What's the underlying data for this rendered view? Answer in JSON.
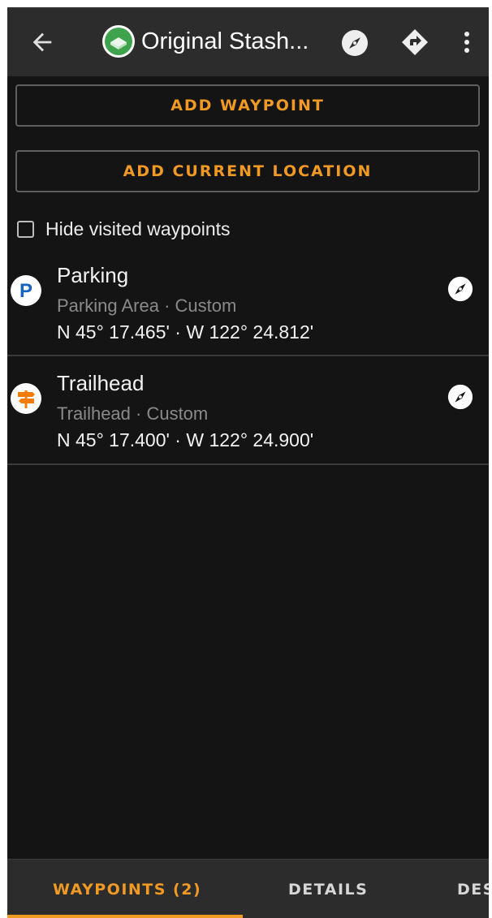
{
  "appbar": {
    "title": "Original Stash...",
    "icons": {
      "back": "arrow-back-icon",
      "cache": "cache-type-icon",
      "compass": "compass-icon",
      "route": "directions-icon",
      "more": "more-vert-icon"
    }
  },
  "actions": {
    "add_waypoint": "ADD WAYPOINT",
    "add_current_location": "ADD CURRENT LOCATION"
  },
  "filter": {
    "hide_visited_label": "Hide visited waypoints",
    "checked": false
  },
  "waypoints": [
    {
      "name": "Parking",
      "subtitle": "Parking Area · Custom",
      "coords": "N 45° 17.465' · W 122° 24.812'",
      "icon": "parking-icon",
      "icon_color": "#1565c0"
    },
    {
      "name": "Trailhead",
      "subtitle": "Trailhead · Custom",
      "coords": "N 45° 17.400' · W 122° 24.900'",
      "icon": "trailhead-signpost-icon",
      "icon_color": "#f57c00"
    }
  ],
  "tabs": [
    {
      "label": "WAYPOINTS (2)",
      "active": true
    },
    {
      "label": "DETAILS",
      "active": false
    },
    {
      "label": "DES",
      "active": false
    }
  ],
  "colors": {
    "accent": "#f09a24",
    "background": "#141414",
    "bar": "#2c2c2c",
    "cache_icon_green": "#3fa34d"
  }
}
